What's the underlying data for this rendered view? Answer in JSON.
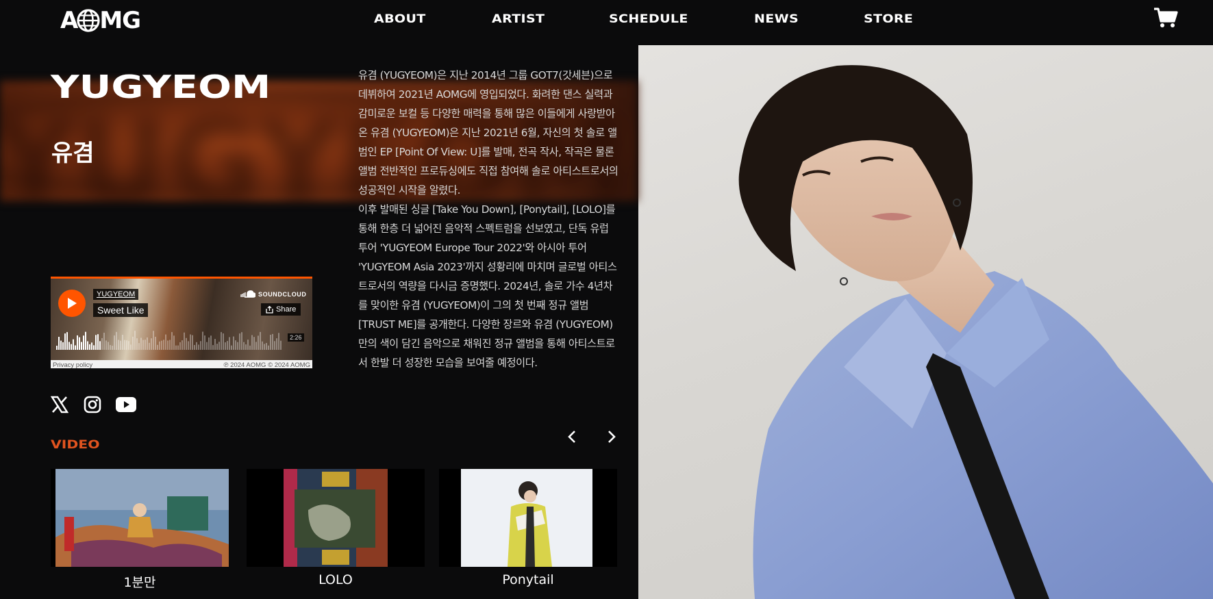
{
  "header": {
    "logo_text": "AOMG",
    "nav": [
      "ABOUT",
      "ARTIST",
      "SCHEDULE",
      "NEWS",
      "STORE"
    ],
    "cart_icon": "cart-icon"
  },
  "artist": {
    "name_en": "YUGYEOM",
    "name_kr": "유겸",
    "bio_p1": "유겸 (YUGYEOM)은 지난 2014년 그룹 GOT7(갓세븐)으로 데뷔하여 2021년 AOMG에 영입되었다. 화려한 댄스 실력과 감미로운 보컬 등 다양한 매력을 통해 많은 이들에게 사랑받아온 유겸 (YUGYEOM)은 지난 2021년 6월, 자신의 첫 솔로 앨범인 EP [Point Of View: U]를 발매, 전곡 작사, 작곡은 물론 앨범 전반적인 프로듀싱에도 직접 참여해 솔로 아티스트로서의 성공적인 시작을 알렸다.",
    "bio_p2": "이후 발매된 싱글 [Take You Down], [Ponytail], [LOLO]를 통해 한층 더 넓어진 음악적 스펙트럼을 선보였고, 단독 유럽 투어 'YUGYEOM Europe Tour 2022'와 아시아 투어 'YUGYEOM Asia 2023'까지 성황리에 마치며 글로벌 아티스트로서의 역량을 다시금 증명했다. 2024년, 솔로 가수 4년차를 맞이한 유겸 (YUGYEOM)이 그의 첫 번째 정규 앨범 [TRUST ME]를 공개한다. 다양한 장르와 유겸 (YUGYEOM)만의 색이 담긴 음악으로 채워진 정규 앨범을 통해 아티스트로서 한발 더 성장한 모습을 보여줄 예정이다."
  },
  "soundcloud": {
    "user": "YUGYEOM",
    "track": "Sweet Like",
    "brand": "SOUNDCLOUD",
    "share_label": "Share",
    "duration": "2:26",
    "privacy": "Privacy policy",
    "copyright": "℗ 2024 AOMG © 2024 AOMG",
    "accent_color": "#ff5500"
  },
  "social": {
    "icons": [
      "x-twitter-icon",
      "instagram-icon",
      "youtube-icon"
    ]
  },
  "video": {
    "section_title": "VIDEO",
    "accent_color": "#e0531f",
    "items": [
      {
        "title": "1분만"
      },
      {
        "title": "LOLO"
      },
      {
        "title": "Ponytail"
      }
    ]
  }
}
